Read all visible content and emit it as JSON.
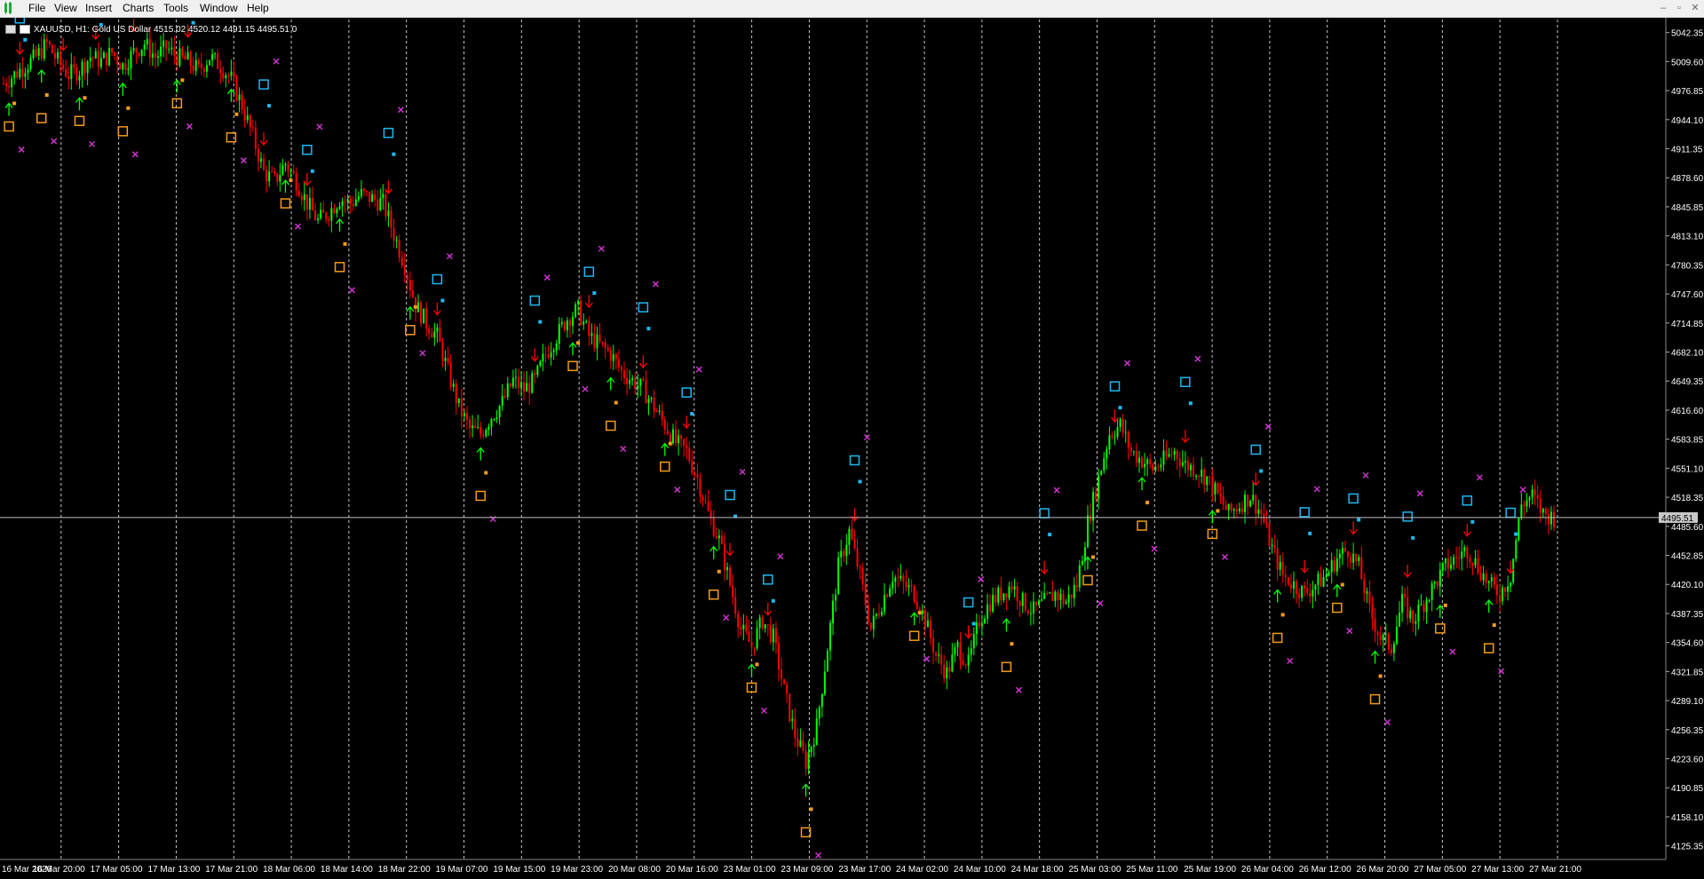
{
  "menu": {
    "items": [
      "File",
      "View",
      "Insert",
      "Charts",
      "Tools",
      "Window",
      "Help"
    ],
    "window_controls": [
      "–",
      "▫",
      "✕"
    ]
  },
  "symbol_info": {
    "text": "XAUUSD, H1:  Gold US Dollar  4515.02 4520.12 4491.15 4495.51  0"
  },
  "colors": {
    "background": "#000000",
    "bull_candle": "#00ff00",
    "bear_candle": "#ff0000",
    "cyan_marker": "#1fb8f0",
    "orange_marker": "#f39c1b",
    "magenta_marker": "#cc33cc",
    "grid": "#c8c8c8"
  },
  "chart_data": {
    "type": "candlestick",
    "symbol": "XAUUSD",
    "timeframe": "H1",
    "description": "Gold US Dollar",
    "ohlc_current": {
      "open": 4515.02,
      "high": 4520.12,
      "low": 4491.15,
      "close": 4495.51
    },
    "current_price": "4495.51",
    "ylim": [
      4110,
      5057
    ],
    "y_ticks": [
      "5042.35",
      "5009.60",
      "4976.85",
      "4944.10",
      "4911.35",
      "4878.60",
      "4845.85",
      "4813.10",
      "4780.35",
      "4747.60",
      "4714.85",
      "4682.10",
      "4649.35",
      "4616.60",
      "4583.85",
      "4551.10",
      "4518.35",
      "4485.60",
      "4452.85",
      "4420.10",
      "4387.35",
      "4354.60",
      "4321.85",
      "4289.10",
      "4256.35",
      "4223.60",
      "4190.85",
      "4158.10",
      "4125.35"
    ],
    "x_ticks": [
      "16 Mar 2026",
      "16 Mar 20:00",
      "17 Mar 05:00",
      "17 Mar 13:00",
      "17 Mar 21:00",
      "18 Mar 06:00",
      "18 Mar 14:00",
      "18 Mar 22:00",
      "19 Mar 07:00",
      "19 Mar 15:00",
      "19 Mar 23:00",
      "20 Mar 08:00",
      "20 Mar 16:00",
      "23 Mar 01:00",
      "23 Mar 09:00",
      "23 Mar 17:00",
      "24 Mar 02:00",
      "24 Mar 10:00",
      "24 Mar 18:00",
      "25 Mar 03:00",
      "25 Mar 11:00",
      "25 Mar 19:00",
      "26 Mar 04:00",
      "26 Mar 12:00",
      "26 Mar 20:00",
      "27 Mar 05:00",
      "27 Mar 13:00",
      "27 Mar 21:00"
    ],
    "close_path": [
      [
        0,
        4985
      ],
      [
        6,
        5000
      ],
      [
        12,
        5015
      ],
      [
        16,
        5030
      ],
      [
        20,
        5010
      ],
      [
        24,
        4995
      ],
      [
        28,
        5000
      ],
      [
        32,
        5015
      ],
      [
        36,
        5010
      ],
      [
        40,
        5020
      ],
      [
        44,
        5005
      ],
      [
        48,
        5020
      ],
      [
        52,
        5030
      ],
      [
        56,
        5015
      ],
      [
        60,
        5025
      ],
      [
        64,
        5015
      ],
      [
        68,
        5010
      ],
      [
        72,
        5000
      ],
      [
        76,
        5015
      ],
      [
        80,
        5005
      ],
      [
        84,
        4990
      ],
      [
        88,
        4960
      ],
      [
        92,
        4925
      ],
      [
        96,
        4885
      ],
      [
        100,
        4875
      ],
      [
        104,
        4895
      ],
      [
        108,
        4875
      ],
      [
        112,
        4850
      ],
      [
        116,
        4830
      ],
      [
        120,
        4840
      ],
      [
        124,
        4855
      ],
      [
        128,
        4850
      ],
      [
        132,
        4860
      ],
      [
        136,
        4855
      ],
      [
        140,
        4850
      ],
      [
        144,
        4815
      ],
      [
        148,
        4780
      ],
      [
        152,
        4735
      ],
      [
        156,
        4715
      ],
      [
        160,
        4700
      ],
      [
        164,
        4660
      ],
      [
        168,
        4620
      ],
      [
        172,
        4595
      ],
      [
        176,
        4590
      ],
      [
        180,
        4610
      ],
      [
        184,
        4625
      ],
      [
        188,
        4650
      ],
      [
        192,
        4640
      ],
      [
        196,
        4650
      ],
      [
        200,
        4680
      ],
      [
        204,
        4700
      ],
      [
        208,
        4720
      ],
      [
        212,
        4730
      ],
      [
        216,
        4700
      ],
      [
        220,
        4690
      ],
      [
        224,
        4680
      ],
      [
        228,
        4660
      ],
      [
        232,
        4650
      ],
      [
        236,
        4640
      ],
      [
        240,
        4620
      ],
      [
        244,
        4600
      ],
      [
        248,
        4580
      ],
      [
        252,
        4570
      ],
      [
        256,
        4540
      ],
      [
        260,
        4500
      ],
      [
        264,
        4470
      ],
      [
        268,
        4420
      ],
      [
        272,
        4370
      ],
      [
        276,
        4350
      ],
      [
        280,
        4380
      ],
      [
        284,
        4360
      ],
      [
        288,
        4300
      ],
      [
        292,
        4250
      ],
      [
        296,
        4220
      ],
      [
        300,
        4260
      ],
      [
        304,
        4350
      ],
      [
        308,
        4440
      ],
      [
        312,
        4480
      ],
      [
        316,
        4430
      ],
      [
        320,
        4370
      ],
      [
        324,
        4400
      ],
      [
        328,
        4430
      ],
      [
        332,
        4420
      ],
      [
        336,
        4410
      ],
      [
        340,
        4380
      ],
      [
        344,
        4340
      ],
      [
        348,
        4320
      ],
      [
        352,
        4350
      ],
      [
        356,
        4330
      ],
      [
        360,
        4380
      ],
      [
        364,
        4400
      ],
      [
        368,
        4410
      ],
      [
        372,
        4420
      ],
      [
        376,
        4400
      ],
      [
        380,
        4390
      ],
      [
        384,
        4400
      ],
      [
        388,
        4410
      ],
      [
        392,
        4400
      ],
      [
        396,
        4420
      ],
      [
        400,
        4490
      ],
      [
        404,
        4540
      ],
      [
        408,
        4590
      ],
      [
        412,
        4600
      ],
      [
        416,
        4570
      ],
      [
        420,
        4560
      ],
      [
        424,
        4550
      ],
      [
        428,
        4560
      ],
      [
        432,
        4570
      ],
      [
        436,
        4555
      ],
      [
        440,
        4550
      ],
      [
        444,
        4540
      ],
      [
        448,
        4520
      ],
      [
        452,
        4500
      ],
      [
        456,
        4510
      ],
      [
        460,
        4520
      ],
      [
        464,
        4500
      ],
      [
        468,
        4460
      ],
      [
        472,
        4430
      ],
      [
        476,
        4420
      ],
      [
        480,
        4410
      ],
      [
        484,
        4420
      ],
      [
        488,
        4430
      ],
      [
        492,
        4450
      ],
      [
        496,
        4460
      ],
      [
        500,
        4440
      ],
      [
        504,
        4390
      ],
      [
        508,
        4360
      ],
      [
        512,
        4350
      ],
      [
        516,
        4400
      ],
      [
        520,
        4380
      ],
      [
        524,
        4400
      ],
      [
        528,
        4420
      ],
      [
        532,
        4440
      ],
      [
        536,
        4450
      ],
      [
        540,
        4460
      ],
      [
        544,
        4440
      ],
      [
        548,
        4420
      ],
      [
        552,
        4410
      ],
      [
        556,
        4430
      ],
      [
        560,
        4510
      ],
      [
        564,
        4520
      ],
      [
        568,
        4500
      ],
      [
        572,
        4495.51
      ]
    ]
  }
}
